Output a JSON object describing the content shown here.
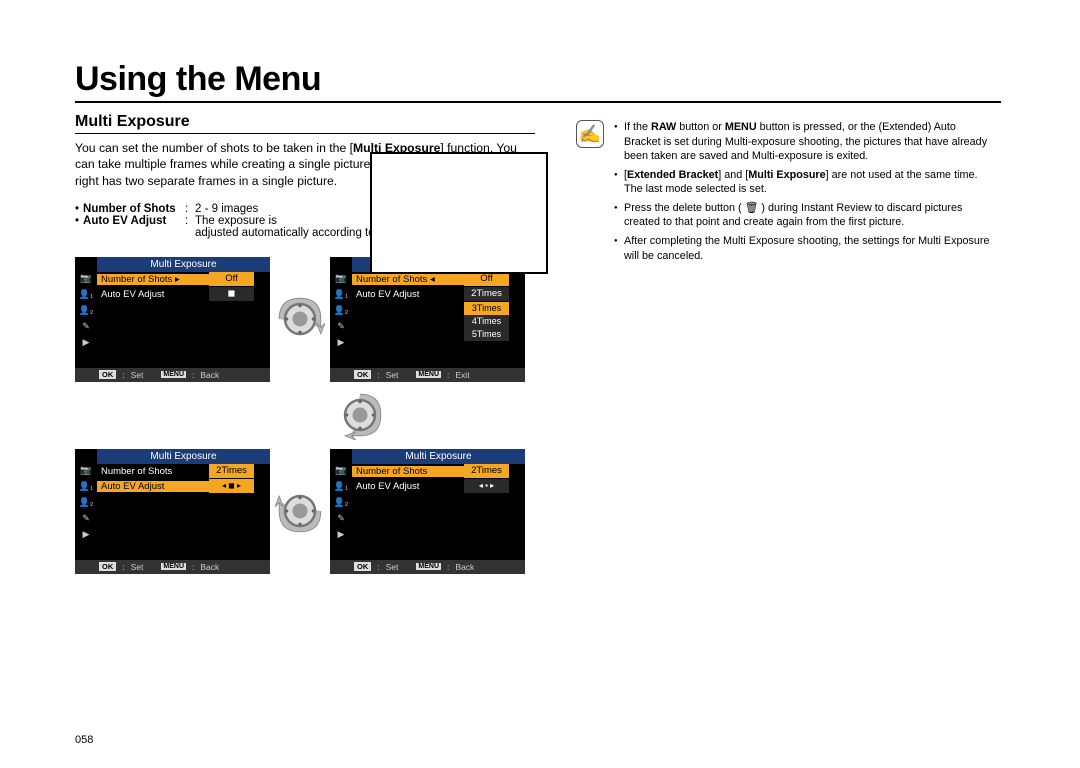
{
  "title": "Using the Menu",
  "section": "Multi Exposure",
  "intro_pre": "You can set the number of shots to be taken in the [",
  "intro_bold": "Multi Exposure",
  "intro_post": "] function. You can take multiple frames while creating a single picture. The image shown on the right has two separate frames in a single picture.",
  "spec1_label": "Number of Shots",
  "spec1_value": "2 - 9 images",
  "spec2_label": "Auto EV Adjust",
  "spec2_value": "The exposure is",
  "spec2_cont": "adjusted automatically according to the number of shots.",
  "lcd": {
    "title": "Multi Exposure",
    "row1": "Number of Shots",
    "row2": "Auto EV Adjust",
    "off": "Off",
    "two": "2Times",
    "opts": [
      "Off",
      "2Times",
      "3Times",
      "4Times",
      "5Times"
    ],
    "ok": "OK",
    "set": "Set",
    "menu": "MENU",
    "back": "Back",
    "exit": "Exit",
    "arrow_r": "▸",
    "arrow_l": "◂",
    "lr": "◂ ◼ ▸",
    "lr2": "◂ ▪ ▸"
  },
  "side_icons": [
    "📷",
    "👤₁",
    "👤₂",
    "✎",
    "▶"
  ],
  "notes": {
    "n1a": "If the ",
    "n1b": "RAW",
    "n1c": " button or ",
    "n1d": "MENU",
    "n1e": " button is pressed, or the (Extended) Auto Bracket is set during Multi-exposure shooting, the pictures that have already been taken are saved and Multi-exposure is exited.",
    "n2a": "[",
    "n2b": "Extended Bracket",
    "n2c": "] and [",
    "n2d": "Multi Exposure",
    "n2e": "] are not used at the same time. The last mode selected is set.",
    "n3": "Press the delete button ( 🗑 ) during Instant Review to discard pictures created to that point and create again from the first picture.",
    "n4": "After completing the Multi Exposure shooting, the settings for Multi Exposure will be canceled."
  },
  "page_number": "058"
}
